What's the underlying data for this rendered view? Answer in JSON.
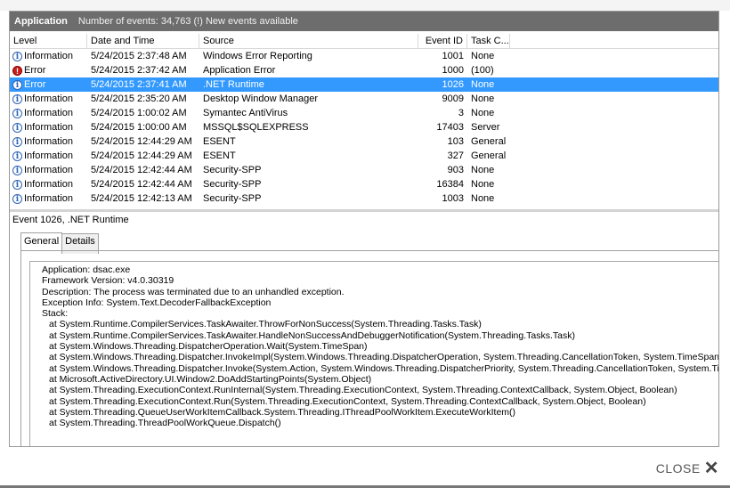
{
  "titlebar": {
    "log_name": "Application",
    "event_count": "Number of events: 34,763 (!) New events available"
  },
  "columns": {
    "level": "Level",
    "date": "Date and Time",
    "source": "Source",
    "event_id": "Event ID",
    "task": "Task C..."
  },
  "rows": [
    {
      "type": "info",
      "level": "Information",
      "date": "5/24/2015 2:37:48 AM",
      "source": "Windows Error Reporting",
      "id": "1001",
      "task": "None",
      "selected": false
    },
    {
      "type": "err",
      "level": "Error",
      "date": "5/24/2015 2:37:42 AM",
      "source": "Application Error",
      "id": "1000",
      "task": "(100)",
      "selected": false
    },
    {
      "type": "info",
      "level": "Error",
      "date": "5/24/2015 2:37:41 AM",
      "source": ".NET Runtime",
      "id": "1026",
      "task": "None",
      "selected": true
    },
    {
      "type": "info",
      "level": "Information",
      "date": "5/24/2015 2:35:20 AM",
      "source": "Desktop Window Manager",
      "id": "9009",
      "task": "None",
      "selected": false
    },
    {
      "type": "info",
      "level": "Information",
      "date": "5/24/2015 1:00:02 AM",
      "source": "Symantec AntiVirus",
      "id": "3",
      "task": "None",
      "selected": false
    },
    {
      "type": "info",
      "level": "Information",
      "date": "5/24/2015 1:00:00 AM",
      "source": "MSSQL$SQLEXPRESS",
      "id": "17403",
      "task": "Server",
      "selected": false
    },
    {
      "type": "info",
      "level": "Information",
      "date": "5/24/2015 12:44:29 AM",
      "source": "ESENT",
      "id": "103",
      "task": "General",
      "selected": false
    },
    {
      "type": "info",
      "level": "Information",
      "date": "5/24/2015 12:44:29 AM",
      "source": "ESENT",
      "id": "327",
      "task": "General",
      "selected": false
    },
    {
      "type": "info",
      "level": "Information",
      "date": "5/24/2015 12:42:44 AM",
      "source": "Security-SPP",
      "id": "903",
      "task": "None",
      "selected": false
    },
    {
      "type": "info",
      "level": "Information",
      "date": "5/24/2015 12:42:44 AM",
      "source": "Security-SPP",
      "id": "16384",
      "task": "None",
      "selected": false
    },
    {
      "type": "info",
      "level": "Information",
      "date": "5/24/2015 12:42:13 AM",
      "source": "Security-SPP",
      "id": "1003",
      "task": "None",
      "selected": false
    }
  ],
  "detail": {
    "title": "Event 1026, .NET Runtime",
    "tabs": [
      "General",
      "Details"
    ],
    "lines": [
      "Application: dsac.exe",
      "Framework Version: v4.0.30319",
      "Description: The process was terminated due to an unhandled exception.",
      "Exception Info: System.Text.DecoderFallbackException",
      "Stack:"
    ],
    "stack": [
      "at System.Runtime.CompilerServices.TaskAwaiter.ThrowForNonSuccess(System.Threading.Tasks.Task)",
      "at System.Runtime.CompilerServices.TaskAwaiter.HandleNonSuccessAndDebuggerNotification(System.Threading.Tasks.Task)",
      "at System.Windows.Threading.DispatcherOperation.Wait(System.TimeSpan)",
      "at System.Windows.Threading.Dispatcher.InvokeImpl(System.Windows.Threading.DispatcherOperation, System.Threading.CancellationToken, System.TimeSpan)",
      "at System.Windows.Threading.Dispatcher.Invoke(System.Action, System.Windows.Threading.DispatcherPriority, System.Threading.CancellationToken, System.TimeSpan)",
      "at Microsoft.ActiveDirectory.UI.Window2.DoAddStartingPoints(System.Object)",
      "at System.Threading.ExecutionContext.RunInternal(System.Threading.ExecutionContext, System.Threading.ContextCallback, System.Object, Boolean)",
      "at System.Threading.ExecutionContext.Run(System.Threading.ExecutionContext, System.Threading.ContextCallback, System.Object, Boolean)",
      "at System.Threading.QueueUserWorkItemCallback.System.Threading.IThreadPoolWorkItem.ExecuteWorkItem()",
      "at System.Threading.ThreadPoolWorkQueue.Dispatch()"
    ]
  },
  "close": {
    "label": "CLOSE",
    "icon": "close-icon"
  }
}
